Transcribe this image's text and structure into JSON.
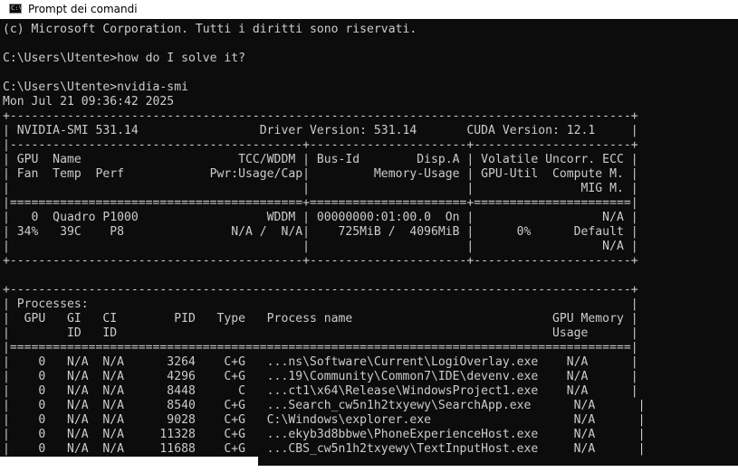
{
  "window": {
    "title": "Prompt dei comandi",
    "icon": "console-app-icon",
    "icon_glyph": "C:\\"
  },
  "console": {
    "lines": [
      "(c) Microsoft Corporation. Tutti i diritti sono riservati.",
      "",
      "C:\\Users\\Utente>how do I solve it?",
      "",
      "C:\\Users\\Utente>nvidia-smi",
      "Mon Jul 21 09:36:42 2025",
      "+---------------------------------------------------------------------------------------+",
      "| NVIDIA-SMI 531.14                 Driver Version: 531.14       CUDA Version: 12.1     |",
      "|-----------------------------------------+----------------------+----------------------+",
      "| GPU  Name                      TCC/WDDM | Bus-Id        Disp.A | Volatile Uncorr. ECC |",
      "| Fan  Temp  Perf            Pwr:Usage/Cap|         Memory-Usage | GPU-Util  Compute M. |",
      "|                                         |                      |               MIG M. |",
      "|=========================================+======================+======================|",
      "|   0  Quadro P1000                  WDDM | 00000000:01:00.0  On |                  N/A |",
      "| 34%   39C    P8               N/A /  N/A|    725MiB /  4096MiB |      0%      Default |",
      "|                                         |                      |                  N/A |",
      "+-----------------------------------------+----------------------+----------------------+",
      "",
      "+---------------------------------------------------------------------------------------+",
      "| Processes:                                                                            |",
      "|  GPU   GI   CI        PID   Type   Process name                            GPU Memory |",
      "|        ID   ID                                                             Usage      |",
      "|=======================================================================================|",
      "|    0   N/A  N/A      3264    C+G   ...ns\\Software\\Current\\LogiOverlay.exe    N/A      |",
      "|    0   N/A  N/A      4296    C+G   ...19\\Community\\Common7\\IDE\\devenv.exe    N/A      |",
      "|    0   N/A  N/A      8448      C   ...ct1\\x64\\Release\\WindowsProject1.exe    N/A      |",
      "|    0   N/A  N/A      8540    C+G   ...Search_cw5n1h2txyewy\\SearchApp.exe      N/A      |",
      "|    0   N/A  N/A      9028    C+G   C:\\Windows\\explorer.exe                    N/A      |",
      "|    0   N/A  N/A     11328    C+G   ...ekyb3d8bbwe\\PhoneExperienceHost.exe     N/A      |",
      "|    0   N/A  N/A     11688    C+G   ...CBS_cw5n1h2txyewy\\TextInputHost.exe     N/A      |"
    ]
  },
  "colors": {
    "console_background": "#0c0c0c",
    "console_text": "#cccccc",
    "titlebar_background": "#ffffff"
  }
}
